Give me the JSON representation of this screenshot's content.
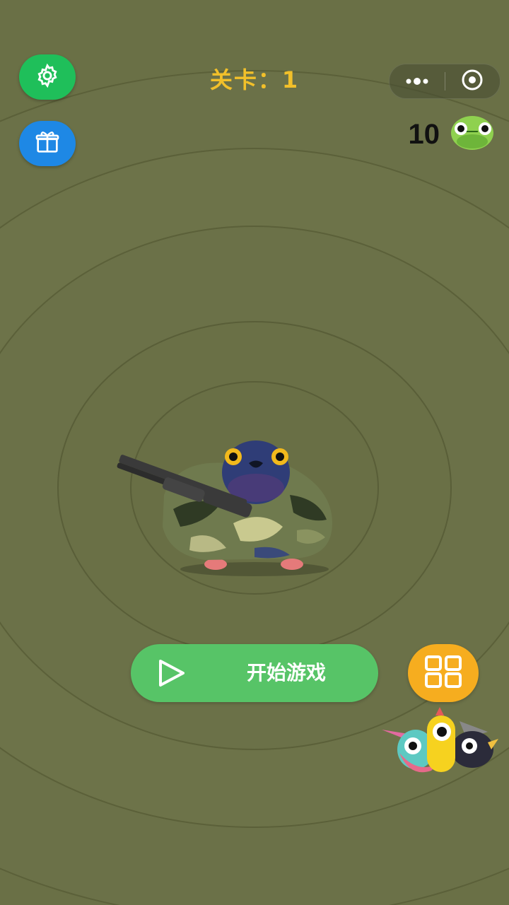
{
  "header": {
    "level_label": "关卡：1",
    "coins": "10"
  },
  "buttons": {
    "settings_icon": "gear-icon",
    "gift_icon": "gift-icon",
    "more_icon": "more-dots-icon",
    "close_icon": "target-circle-icon",
    "grid_icon": "grid-menu-icon",
    "start_label": "开始游戏"
  },
  "colors": {
    "background": "#6a7046",
    "settings_button": "#1fbf5a",
    "gift_button": "#1e88e5",
    "level_text": "#f2c02a",
    "start_button": "#57c467",
    "grid_button": "#f6ad1f"
  }
}
